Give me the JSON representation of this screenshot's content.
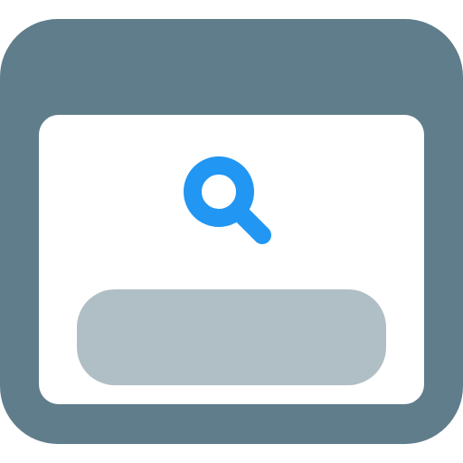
{
  "icon": {
    "semantic": "browser-search-icon",
    "parts": [
      "browser-window-icon",
      "search-icon",
      "search-bar-placeholder"
    ]
  },
  "colors": {
    "frame": "#607D8B",
    "content": "#FFFFFF",
    "search_glyph": "#2196F3",
    "search_bar": "#B0BEC5"
  }
}
